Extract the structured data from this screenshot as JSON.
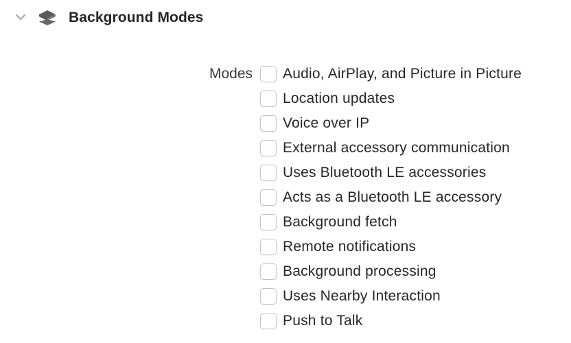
{
  "section": {
    "title": "Background Modes",
    "expanded": true,
    "icon": "capability-layers-icon",
    "disclosure_icon": "chevron-down-icon"
  },
  "modes": {
    "label": "Modes",
    "items": [
      {
        "label": "Audio, AirPlay, and Picture in Picture",
        "checked": false
      },
      {
        "label": "Location updates",
        "checked": false
      },
      {
        "label": "Voice over IP",
        "checked": false
      },
      {
        "label": "External accessory communication",
        "checked": false
      },
      {
        "label": "Uses Bluetooth LE accessories",
        "checked": false
      },
      {
        "label": "Acts as a Bluetooth LE accessory",
        "checked": false
      },
      {
        "label": "Background fetch",
        "checked": false
      },
      {
        "label": "Remote notifications",
        "checked": false
      },
      {
        "label": "Background processing",
        "checked": false
      },
      {
        "label": "Uses Nearby Interaction",
        "checked": false
      },
      {
        "label": "Push to Talk",
        "checked": false
      }
    ]
  },
  "colors": {
    "text": "#262626",
    "checkbox_border": "#c3c3c3",
    "icon": "#5a5a5a",
    "accent": "#0a7cff"
  }
}
